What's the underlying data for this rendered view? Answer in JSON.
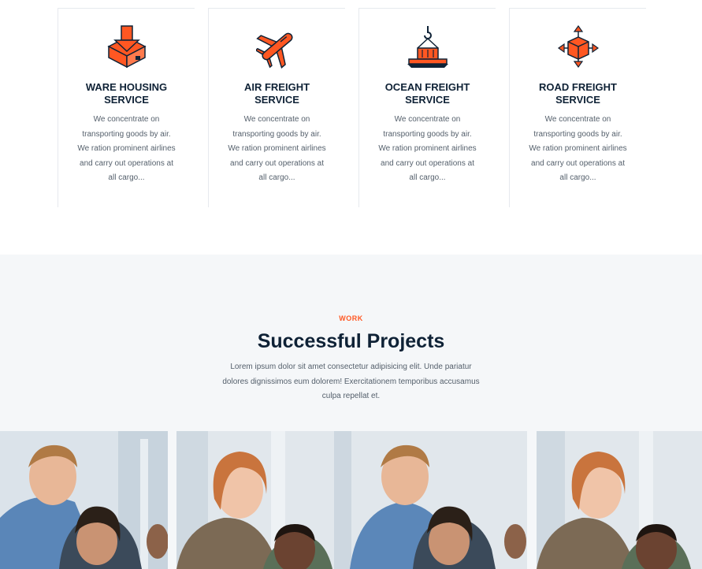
{
  "services": [
    {
      "icon": "warehouse-box-icon",
      "title_line1": "WARE HOUSING",
      "title_line2": "SERVICE",
      "description": "We concentrate on transporting goods by air. We ration prominent airlines and carry out operations at all cargo..."
    },
    {
      "icon": "airplane-icon",
      "title_line1": "AIR FREIGHT",
      "title_line2": "SERVICE",
      "description": "We concentrate on transporting goods by air. We ration prominent airlines and carry out operations at all cargo..."
    },
    {
      "icon": "ship-container-icon",
      "title_line1": "OCEAN FREIGHT",
      "title_line2": "SERVICE",
      "description": "We concentrate on transporting goods by air. We ration prominent airlines and carry out operations at all cargo..."
    },
    {
      "icon": "road-box-arrows-icon",
      "title_line1": "ROAD FREIGHT",
      "title_line2": "SERVICE",
      "description": "We concentrate on transporting goods by air. We ration prominent airlines and carry out operations at all cargo..."
    }
  ],
  "projects": {
    "eyebrow": "WORK",
    "title": "Successful Projects",
    "description": "Lorem ipsum dolor sit amet consectetur adipisicing elit. Unde pariatur dolores dignissimos eum dolorem! Exercitationem temporibus accusamus culpa repellat et."
  },
  "colors": {
    "accent": "#ff5722",
    "navy": "#0f2236",
    "text": "#55606c",
    "section_bg": "#f5f7f9"
  },
  "gallery": [
    {
      "name": "project-photo-1"
    },
    {
      "name": "project-photo-2"
    },
    {
      "name": "project-photo-3"
    }
  ]
}
